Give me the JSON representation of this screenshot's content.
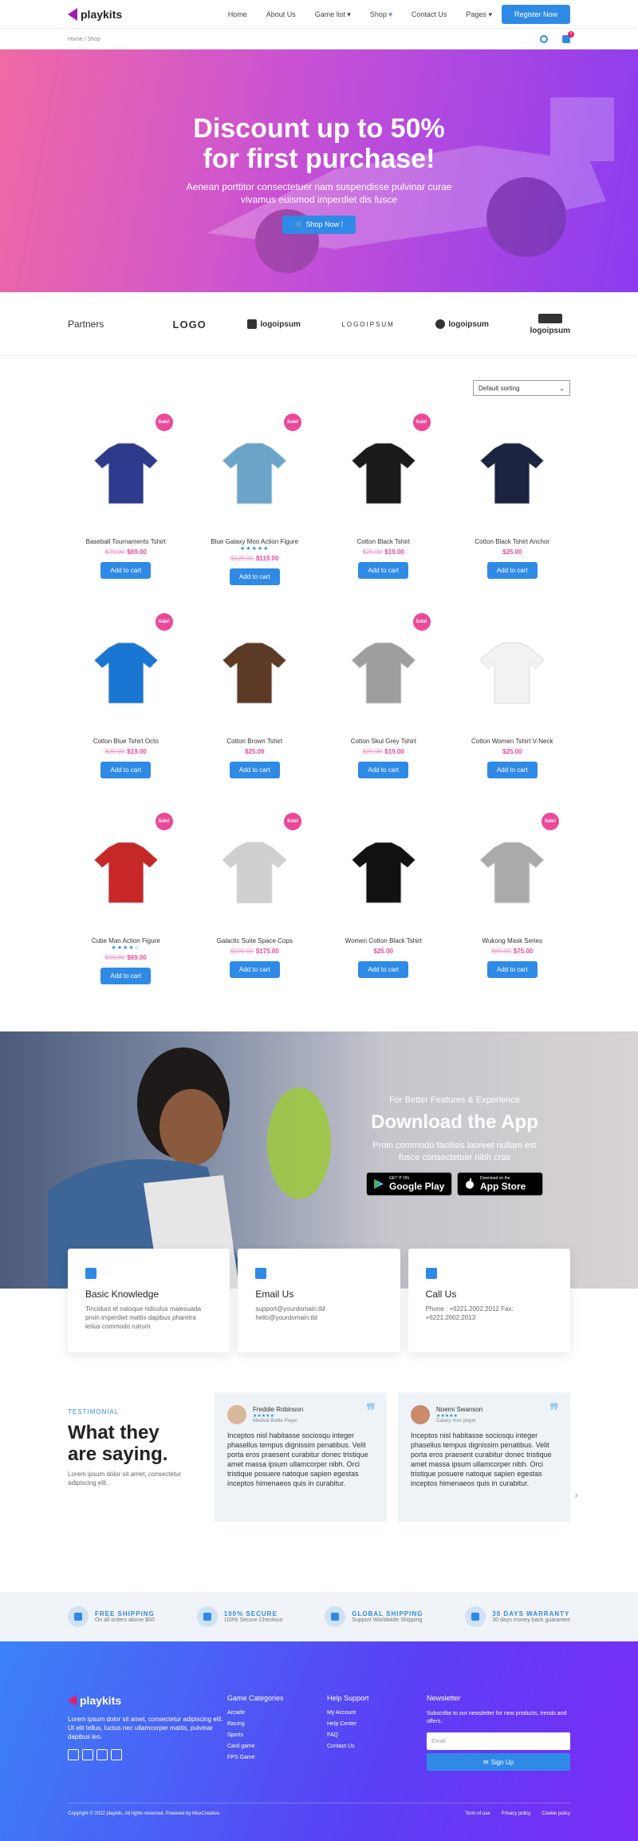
{
  "header": {
    "logo": "playkits",
    "nav": [
      "Home",
      "About Us",
      "Game list",
      "Shop",
      "Contact Us",
      "Pages"
    ],
    "register": "Register Now"
  },
  "breadcrumb": "Home / Shop",
  "cart_count": "0",
  "hero": {
    "title1": "Discount up to 50%",
    "title2": "for first purchase!",
    "subtitle1": "Aenean porttitor consectetuer nam suspendisse pulvinar curae",
    "subtitle2": "vivamus euismod imperdiet dis fusce",
    "cta": "Shop Now !"
  },
  "partners": {
    "title": "Partners",
    "logos": [
      "LOGO",
      "logoipsum",
      "LOGOIPSUM",
      "logoipsum",
      "logoipsum"
    ]
  },
  "sort": "Default sorting",
  "products": [
    {
      "name": "Baseball Tournaments Tshirt",
      "old": "$79.00",
      "new": "$69.00",
      "sale": "Sale!",
      "btn": "Add to cart"
    },
    {
      "name": "Blue Galaxy Moo Action Figure",
      "stars": "★★★★★",
      "old": "$129.00",
      "new": "$119.00",
      "sale": "Sale!",
      "btn": "Add to cart"
    },
    {
      "name": "Cotton Black Tshirt",
      "old": "$25.00",
      "new": "$19.00",
      "sale": "Sale!",
      "btn": "Add to cart"
    },
    {
      "name": "Cotton Black Tshirt Anchor",
      "new": "$25.00",
      "btn": "Add to cart"
    },
    {
      "name": "Cotton Blue Tshirt Octo",
      "old": "$25.00",
      "new": "$19.00",
      "sale": "Sale!",
      "btn": "Add to cart"
    },
    {
      "name": "Cotton Brown Tshirt",
      "new": "$25.00",
      "btn": "Add to cart"
    },
    {
      "name": "Cotton Skul Grey Tshirt",
      "old": "$25.00",
      "new": "$19.00",
      "sale": "Sale!",
      "btn": "Add to cart"
    },
    {
      "name": "Cotton Women Tshirt V-Neck",
      "new": "$25.00",
      "btn": "Add to cart"
    },
    {
      "name": "Cube Man Action Figure",
      "stars": "★★★★☆",
      "old": "$99.00",
      "new": "$69.00",
      "sale": "Sale!",
      "btn": "Add to cart"
    },
    {
      "name": "Galactic Suite Space Cops",
      "old": "$199.00",
      "new": "$175.00",
      "sale": "Sale!",
      "btn": "Add to cart"
    },
    {
      "name": "Women Cotton Black Tshirt",
      "new": "$25.00",
      "btn": "Add to cart"
    },
    {
      "name": "Wukong Mask Series",
      "old": "$89.00",
      "new": "$75.00",
      "sale": "Sale!",
      "btn": "Add to cart"
    }
  ],
  "app": {
    "small": "For Better Features & Experience",
    "title": "Download the App",
    "desc1": "Proin commodo facilisis laoreet nullam est",
    "desc2": "fusce consectetuer nibh cras",
    "gp_small": "GET IT ON",
    "gp": "Google Play",
    "as_small": "Download on the",
    "as": "App Store"
  },
  "info": [
    {
      "title": "Basic Knowledge",
      "text": "Tincidunt et natoque ridiculus malesuada proin imperdiet mattis dapibus pharetra letius commodo rutrum"
    },
    {
      "title": "Email Us",
      "text": "support@yourdomain.tld hello@yourdomain.tld"
    },
    {
      "title": "Call Us",
      "text": "Phone : +6221.2002.2012 Fax: +6221.2002.2013"
    }
  ],
  "testimonial": {
    "label": "TESTIMONIAL",
    "title1": "What they",
    "title2": "are saying.",
    "desc": "Lorem ipsum dolor sit amet, consectetur adipiscing elit.",
    "items": [
      {
        "name": "Freddie Robinson",
        "stars": "★★★★★",
        "role": "Medival Battle Player",
        "text": "Inceptos nisl habitasse sociosqu integer phasellus tempus dignissim penatibus. Velit porta eros praesent curabitur donec tristique amet massa ipsum ullamcorper nibh. Orci tristique posuere natoque sapien egestas inceptos himenaeos quis in curabitur."
      },
      {
        "name": "Noemi Swanson",
        "stars": "★★★★★",
        "role": "Galaxy moo player",
        "text": "Inceptos nisl habitasse sociosqu integer phasellus tempus dignissim penatibus. Velit porta eros praesent curabitur donec tristique amet massa ipsum ullamcorper nibh. Orci tristique posuere natoque sapien egestas inceptos himenaeos quis in curabitur."
      }
    ]
  },
  "features": [
    {
      "title": "FREE SHIPPING",
      "sub": "On all orders above $50"
    },
    {
      "title": "100% SECURE",
      "sub": "100% Secure Checkout"
    },
    {
      "title": "GLOBAL SHIPPING",
      "sub": "Support Worldwide Shipping"
    },
    {
      "title": "30 DAYS WARRANTY",
      "sub": "30 days money back guarantee"
    }
  ],
  "footer": {
    "logo": "playkits",
    "about": "Lorem ipsum dolor sit amet, consectetur adipiscing elit. Ut elit tellus, luctus nec ullamcorper mattis, pulvinar dapibus leo.",
    "col1": {
      "title": "Game Categories",
      "items": [
        "Arcade",
        "Racing",
        "Sports",
        "Card game",
        "FPS Game"
      ]
    },
    "col2": {
      "title": "Help Support",
      "items": [
        "My Account",
        "Help Center",
        "FAQ",
        "Contact Us"
      ]
    },
    "news": {
      "title": "Newsletter",
      "text": "Subscribe to our newsletter for new products, trends and offers.",
      "placeholder": "Email",
      "btn": "Sign Up"
    },
    "copyright": "Copyright © 2022 playkits, All rights reserved. Powered by MoxCreative.",
    "links": [
      "Term of use",
      "Privacy policy",
      "Cookie policy"
    ]
  }
}
